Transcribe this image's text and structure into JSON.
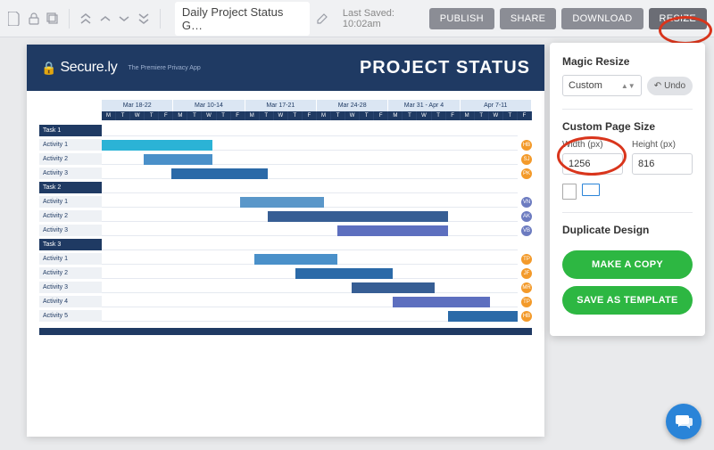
{
  "toolbar": {
    "doc_title": "Daily Project Status G…",
    "last_saved": "Last Saved: 10:02am",
    "buttons": {
      "publish": "PUBLISH",
      "share": "SHARE",
      "download": "DOWNLOAD",
      "resize": "RESIZE"
    }
  },
  "canvas": {
    "brand_name": "Secure.ly",
    "brand_tag": "The Premiere Privacy App",
    "title": "PROJECT STATUS"
  },
  "panel": {
    "magic_resize": "Magic Resize",
    "preset": "Custom",
    "undo": "Undo",
    "custom_page_size": "Custom Page Size",
    "width_label": "Width (px)",
    "height_label": "Height (px)",
    "width_value": "1256",
    "height_value": "816",
    "duplicate": "Duplicate Design",
    "make_copy": "MAKE A COPY",
    "save_tpl": "SAVE AS TEMPLATE"
  },
  "chart_data": {
    "type": "gantt",
    "title": "PROJECT STATUS",
    "weeks": [
      "Mar 18-22",
      "Mar 10-14",
      "Mar 17-21",
      "Mar 24-28",
      "Mar 31 - Apr 4",
      "Apr 7-11"
    ],
    "days": [
      "M",
      "T",
      "W",
      "T",
      "F"
    ],
    "rows": [
      {
        "kind": "task",
        "label": "Task 1"
      },
      {
        "kind": "activity",
        "label": "Activity 1",
        "start": 0,
        "span": 8,
        "color": "#2bb3d6",
        "badge": "HB",
        "badge_color": "#f39a2a"
      },
      {
        "kind": "activity",
        "label": "Activity 2",
        "start": 3,
        "span": 5,
        "color": "#4a90c9",
        "badge": "SJ",
        "badge_color": "#f39a2a"
      },
      {
        "kind": "activity",
        "label": "Activity 3",
        "start": 5,
        "span": 7,
        "color": "#2b6aa8",
        "badge": "PK",
        "badge_color": "#f39a2a"
      },
      {
        "kind": "task",
        "label": "Task 2"
      },
      {
        "kind": "activity",
        "label": "Activity 1",
        "start": 10,
        "span": 6,
        "color": "#5a97c9",
        "badge": "VN",
        "badge_color": "#6c7bc0"
      },
      {
        "kind": "activity",
        "label": "Activity 2",
        "start": 12,
        "span": 13,
        "color": "#375e94",
        "badge": "AK",
        "badge_color": "#6c7bc0"
      },
      {
        "kind": "activity",
        "label": "Activity 3",
        "start": 17,
        "span": 8,
        "color": "#5d6fbf",
        "badge": "VB",
        "badge_color": "#6c7bc0"
      },
      {
        "kind": "task",
        "label": "Task 3"
      },
      {
        "kind": "activity",
        "label": "Activity 1",
        "start": 11,
        "span": 6,
        "color": "#4a90c9",
        "badge": "TP",
        "badge_color": "#f39a2a"
      },
      {
        "kind": "activity",
        "label": "Activity 2",
        "start": 14,
        "span": 7,
        "color": "#2b6aa8",
        "badge": "JF",
        "badge_color": "#f39a2a"
      },
      {
        "kind": "activity",
        "label": "Activity 3",
        "start": 18,
        "span": 6,
        "color": "#375e94",
        "badge": "MR",
        "badge_color": "#f39a2a"
      },
      {
        "kind": "activity",
        "label": "Activity 4",
        "start": 21,
        "span": 7,
        "color": "#5d6fbf",
        "badge": "TP",
        "badge_color": "#f39a2a"
      },
      {
        "kind": "activity",
        "label": "Activity 5",
        "start": 25,
        "span": 5,
        "color": "#2b6aa8",
        "badge": "HB",
        "badge_color": "#f39a2a"
      }
    ],
    "total_days": 30
  }
}
